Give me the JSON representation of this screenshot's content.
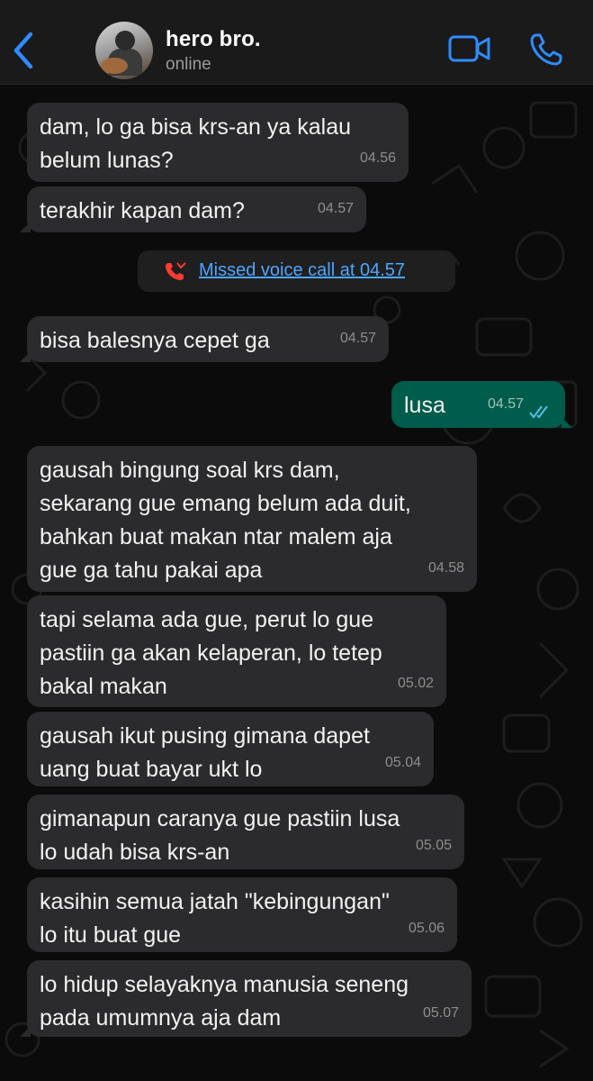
{
  "header": {
    "contact_name": "hero bro.",
    "status": "online",
    "icons": [
      "back-chevron-icon",
      "avatar",
      "video-call-icon",
      "phone-icon"
    ],
    "accent_color": "#2f8cff"
  },
  "messages": [
    {
      "dir": "in",
      "text": "dam, lo ga bisa krs-an ya kalau\nbelum lunas?",
      "time": "04.56"
    },
    {
      "dir": "in",
      "text": "terakhir kapan dam?",
      "time": "04.57"
    },
    {
      "dir": "system",
      "text": "Missed voice call at 04.57"
    },
    {
      "dir": "in",
      "text": "bisa balesnya cepet ga",
      "time": "04.57"
    },
    {
      "dir": "out",
      "text": "lusa",
      "time": "04.57",
      "read": true
    },
    {
      "dir": "in",
      "text": "gausah bingung soal krs dam,\nsekarang gue emang belum ada duit,\nbahkan buat makan ntar malem aja\ngue ga tahu pakai apa",
      "time": "04.58"
    },
    {
      "dir": "in",
      "text": "tapi selama ada gue, perut lo gue\npastiin ga akan kelaperan, lo tetep\nbakal makan",
      "time": "05.02"
    },
    {
      "dir": "in",
      "text": "gausah ikut pusing gimana dapet\nuang buat bayar ukt lo",
      "time": "05.04"
    },
    {
      "dir": "in",
      "text": "gimanapun caranya gue pastiin lusa\nlo udah bisa krs-an",
      "time": "05.05"
    },
    {
      "dir": "in",
      "text": "kasihin semua jatah \"kebingungan\"\nlo itu buat gue",
      "time": "05.06"
    },
    {
      "dir": "in",
      "text": "lo hidup selayaknya manusia seneng\npada umumnya aja dam",
      "time": "05.07"
    }
  ],
  "colors": {
    "incoming_bubble": "#2b2b2d",
    "outgoing_bubble": "#005c4b",
    "missed_call": "#ff3b30",
    "link": "#4ea6ff"
  }
}
